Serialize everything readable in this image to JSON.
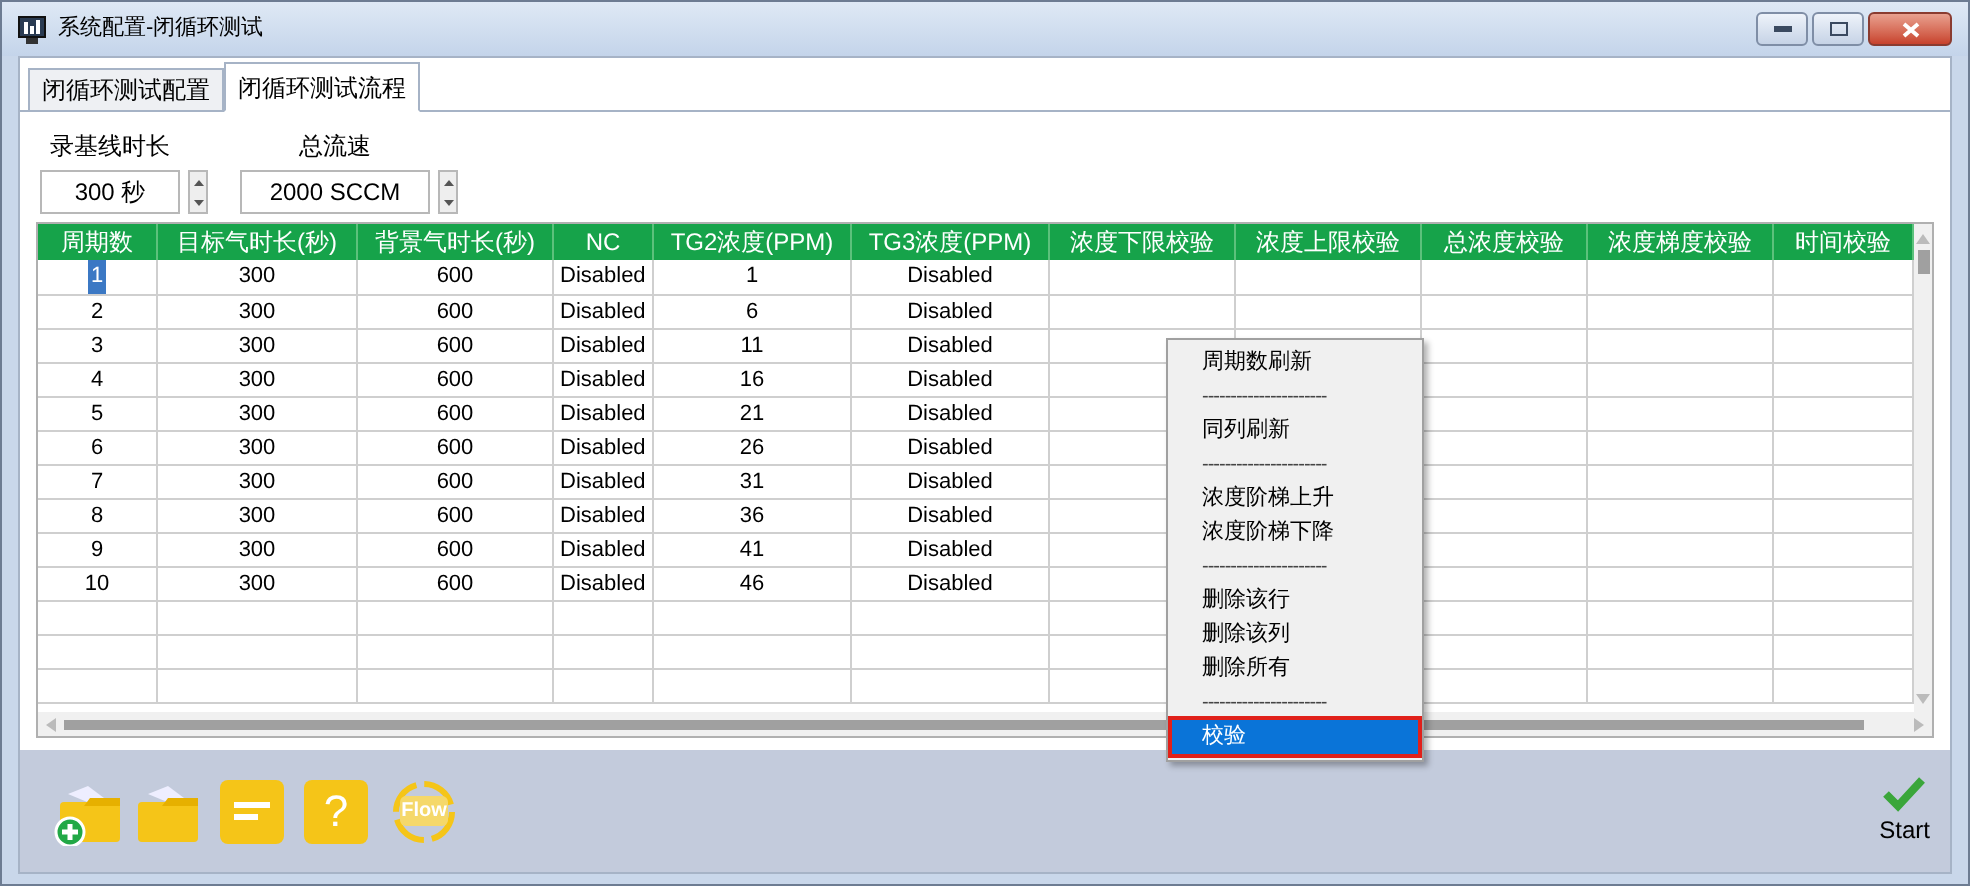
{
  "window": {
    "title": "系统配置-闭循环测试"
  },
  "tabs": [
    {
      "label": "闭循环测试配置",
      "selected": false
    },
    {
      "label": "闭循环测试流程",
      "selected": true
    }
  ],
  "settings": [
    {
      "label": "录基线时长",
      "value": "300 秒"
    },
    {
      "label": "总流速",
      "value": "2000 SCCM"
    }
  ],
  "table": {
    "columns": [
      "周期数",
      "目标气时长(秒)",
      "背景气时长(秒)",
      "NC",
      "TG2浓度(PPM)",
      "TG3浓度(PPM)",
      "浓度下限校验",
      "浓度上限校验",
      "总浓度校验",
      "浓度梯度校验",
      "时间校验"
    ],
    "rows": [
      {
        "selected": true,
        "cells": [
          "1",
          "300",
          "600",
          "Disabled",
          "1",
          "Disabled"
        ]
      },
      {
        "selected": false,
        "cells": [
          "2",
          "300",
          "600",
          "Disabled",
          "6",
          "Disabled"
        ]
      },
      {
        "selected": false,
        "cells": [
          "3",
          "300",
          "600",
          "Disabled",
          "11",
          "Disabled"
        ]
      },
      {
        "selected": false,
        "cells": [
          "4",
          "300",
          "600",
          "Disabled",
          "16",
          "Disabled"
        ]
      },
      {
        "selected": false,
        "cells": [
          "5",
          "300",
          "600",
          "Disabled",
          "21",
          "Disabled"
        ]
      },
      {
        "selected": false,
        "cells": [
          "6",
          "300",
          "600",
          "Disabled",
          "26",
          "Disabled"
        ]
      },
      {
        "selected": false,
        "cells": [
          "7",
          "300",
          "600",
          "Disabled",
          "31",
          "Disabled"
        ]
      },
      {
        "selected": false,
        "cells": [
          "8",
          "300",
          "600",
          "Disabled",
          "36",
          "Disabled"
        ]
      },
      {
        "selected": false,
        "cells": [
          "9",
          "300",
          "600",
          "Disabled",
          "41",
          "Disabled"
        ]
      },
      {
        "selected": false,
        "cells": [
          "10",
          "300",
          "600",
          "Disabled",
          "46",
          "Disabled"
        ]
      }
    ]
  },
  "context_menu": {
    "items": [
      {
        "kind": "item",
        "label": "周期数刷新",
        "selected": false
      },
      {
        "kind": "separator",
        "label": "----------------------"
      },
      {
        "kind": "item",
        "label": "同列刷新",
        "selected": false
      },
      {
        "kind": "separator",
        "label": "----------------------"
      },
      {
        "kind": "item",
        "label": "浓度阶梯上升",
        "selected": false
      },
      {
        "kind": "item",
        "label": "浓度阶梯下降",
        "selected": false
      },
      {
        "kind": "separator",
        "label": "----------------------"
      },
      {
        "kind": "item",
        "label": "删除该行",
        "selected": false
      },
      {
        "kind": "item",
        "label": "删除该列",
        "selected": false
      },
      {
        "kind": "item",
        "label": "删除所有",
        "selected": false
      },
      {
        "kind": "separator",
        "label": "----------------------"
      },
      {
        "kind": "item",
        "label": "校验",
        "selected": true
      }
    ]
  },
  "toolbar": {
    "help_label": "?",
    "flow_label": "Flow",
    "start_label": "Start"
  }
}
